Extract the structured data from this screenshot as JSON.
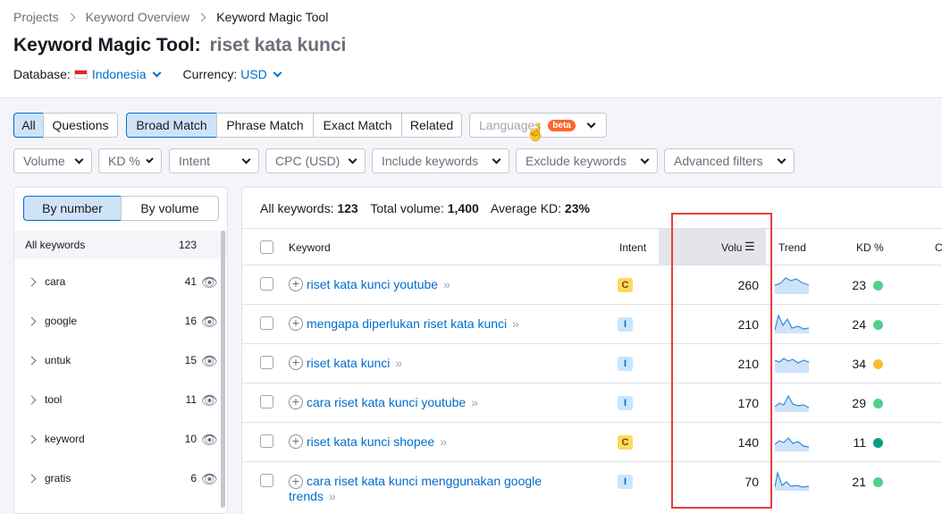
{
  "breadcrumb": [
    "Projects",
    "Keyword Overview",
    "Keyword Magic Tool"
  ],
  "title": {
    "label": "Keyword Magic Tool:",
    "query": "riset kata kunci"
  },
  "database": {
    "label": "Database:",
    "value": "Indonesia"
  },
  "currency": {
    "label": "Currency:",
    "value": "USD"
  },
  "match_tabs": [
    "All",
    "Questions",
    "Broad Match",
    "Phrase Match",
    "Exact Match",
    "Related"
  ],
  "languages": {
    "label": "Languages",
    "badge": "beta"
  },
  "filters": [
    "Volume",
    "KD %",
    "Intent",
    "CPC (USD)",
    "Include keywords",
    "Exclude keywords",
    "Advanced filters"
  ],
  "sidebar": {
    "toggle": [
      "By number",
      "By volume"
    ],
    "all": {
      "label": "All keywords",
      "count": "123"
    },
    "groups": [
      {
        "label": "cara",
        "count": "41"
      },
      {
        "label": "google",
        "count": "16"
      },
      {
        "label": "untuk",
        "count": "15"
      },
      {
        "label": "tool",
        "count": "11"
      },
      {
        "label": "keyword",
        "count": "10"
      },
      {
        "label": "gratis",
        "count": "6"
      }
    ]
  },
  "summary": {
    "all_label": "All keywords:",
    "all_value": "123",
    "vol_label": "Total volume:",
    "vol_value": "1,400",
    "kd_label": "Average KD:",
    "kd_value": "23%"
  },
  "table": {
    "headers": {
      "keyword": "Keyword",
      "intent": "Intent",
      "volume": "Volu",
      "trend": "Trend",
      "kd": "KD %",
      "cut": "C"
    },
    "rows": [
      {
        "keyword": "riset kata kunci youtube",
        "intent": "C",
        "volume": "260",
        "kd": "23",
        "kd_color": "#4fd18b"
      },
      {
        "keyword": "mengapa diperlukan riset kata kunci",
        "intent": "I",
        "volume": "210",
        "kd": "24",
        "kd_color": "#4fd18b"
      },
      {
        "keyword": "riset kata kunci",
        "intent": "I",
        "volume": "210",
        "kd": "34",
        "kd_color": "#fbbc31"
      },
      {
        "keyword": "cara riset kata kunci youtube",
        "intent": "I",
        "volume": "170",
        "kd": "29",
        "kd_color": "#4fd18b"
      },
      {
        "keyword": "riset kata kunci shopee",
        "intent": "C",
        "volume": "140",
        "kd": "11",
        "kd_color": "#009f81"
      },
      {
        "keyword": "cara riset kata kunci menggunakan google trends",
        "intent": "I",
        "volume": "70",
        "kd": "21",
        "kd_color": "#4fd18b"
      }
    ]
  },
  "colors": {
    "accent": "#006dca",
    "highlight": "#e73f3c"
  }
}
